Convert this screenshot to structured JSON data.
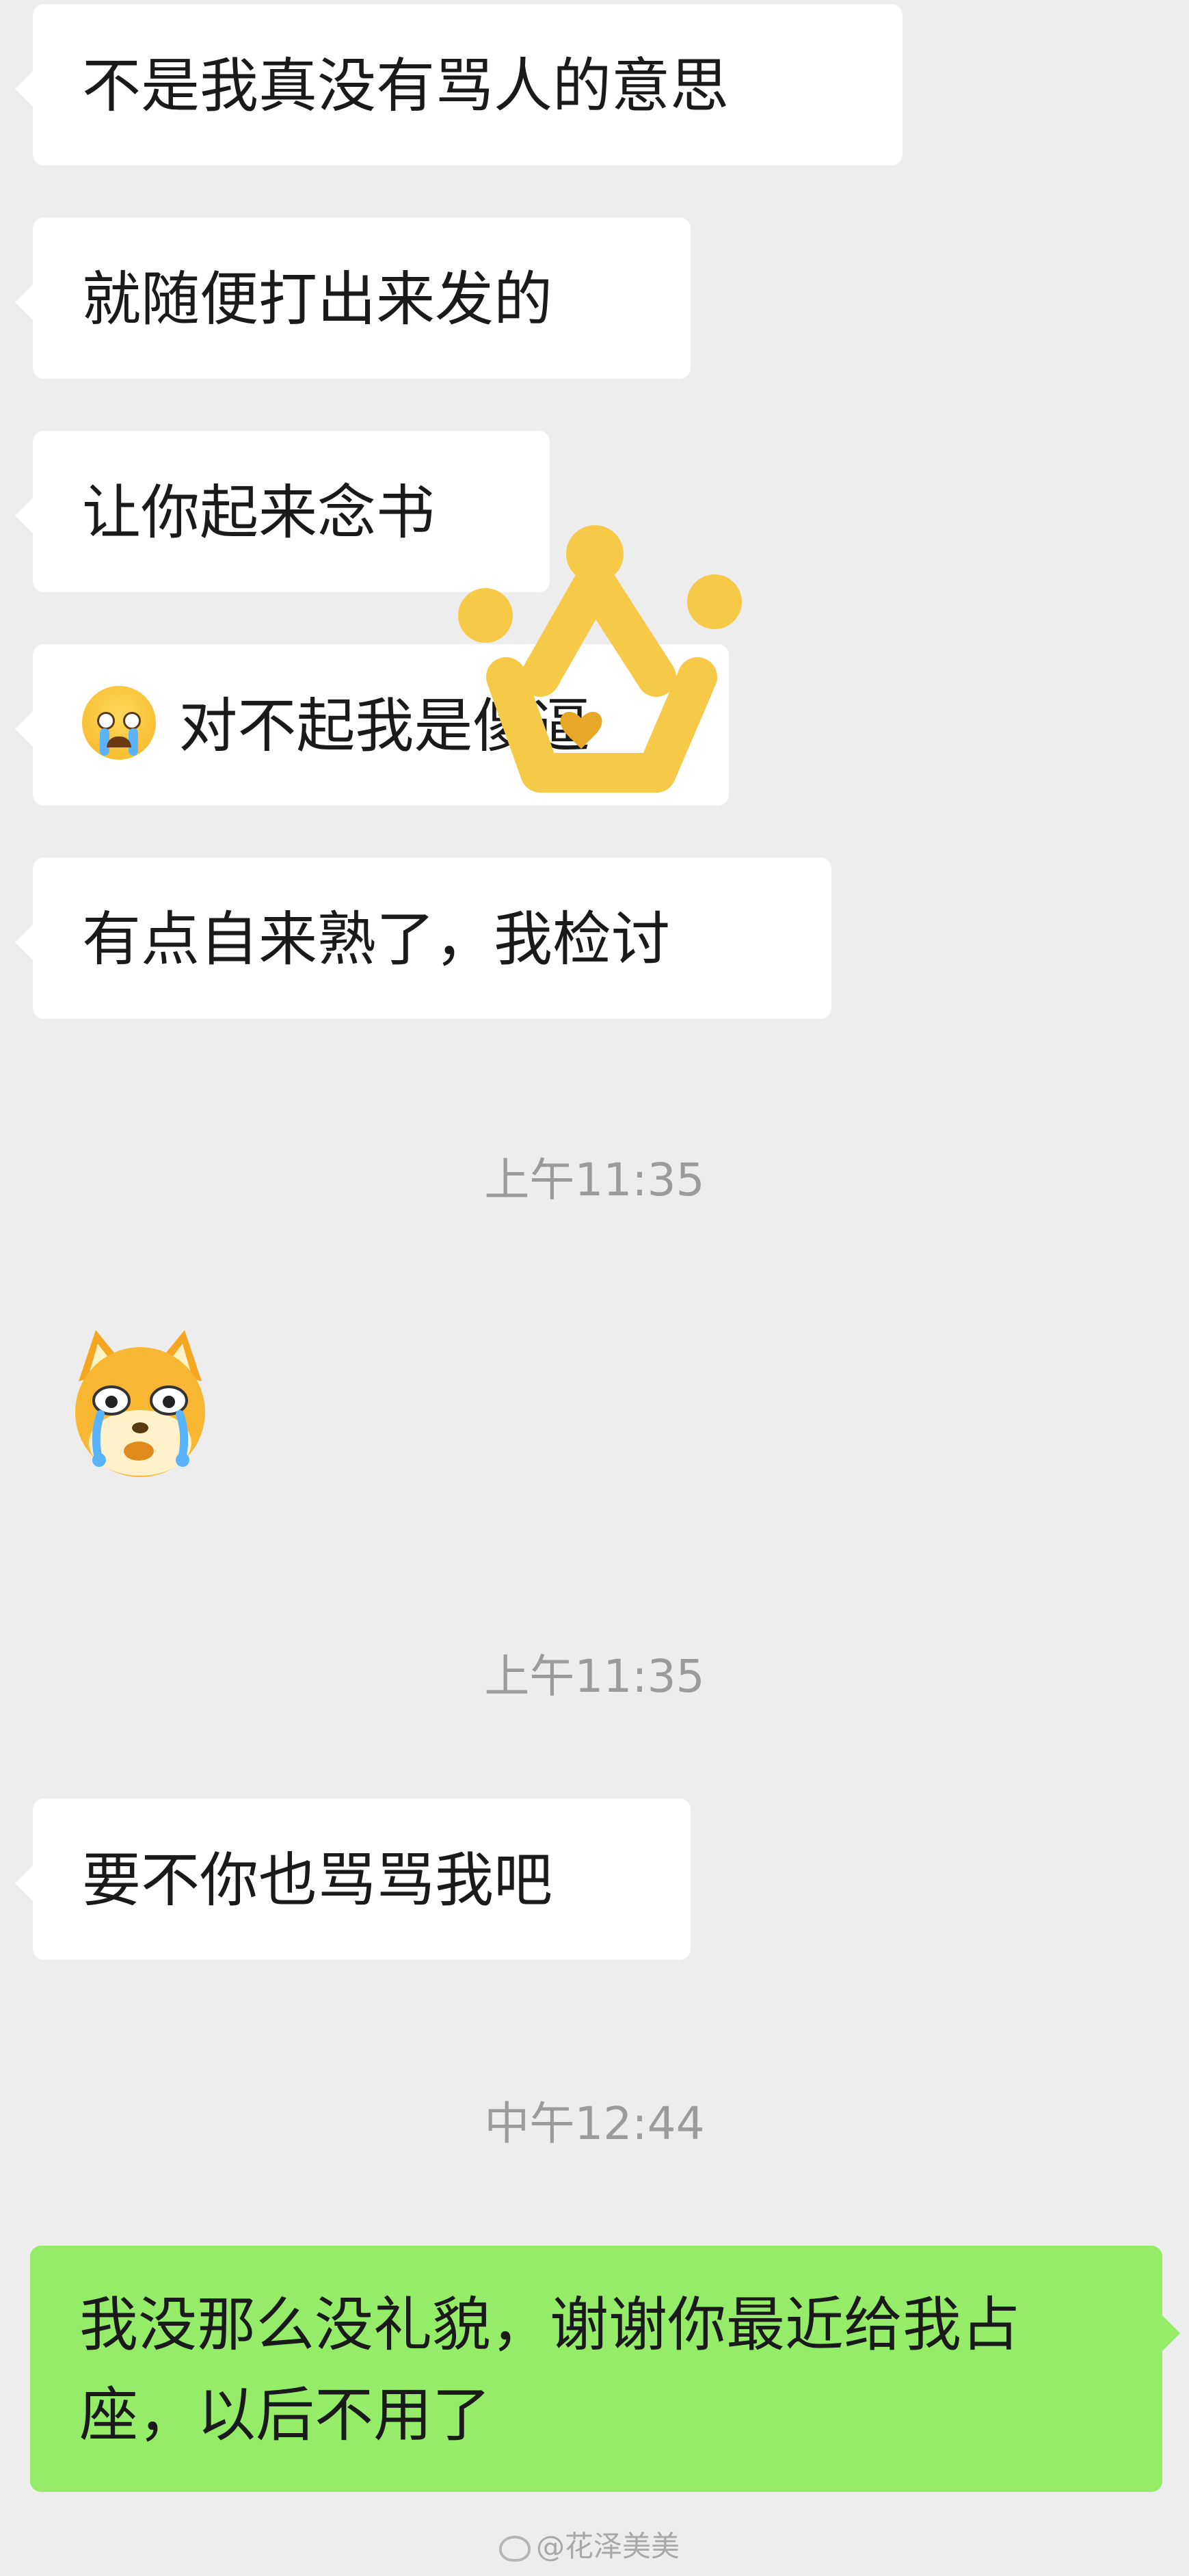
{
  "messages": [
    {
      "text": "不是我真没有骂人的意思"
    },
    {
      "text": "就随便打出来发的"
    },
    {
      "text": "让你起来念书"
    },
    {
      "text": "对不起我是傻逼",
      "emoji": "crying-face-emoji"
    },
    {
      "text": "有点自来熟了，我检讨"
    },
    {
      "text": "要不你也骂骂我吧"
    },
    {
      "text": "我没那么没礼貌，谢谢你最近给我占座，以后不用了"
    }
  ],
  "timestamps": [
    "上午11:35",
    "上午11:35",
    "中午12:44"
  ],
  "sticker": {
    "icon": "crying-shiba-dog-sticker"
  },
  "overlay": {
    "icon": "crown-sticker",
    "color": "#f7c948"
  },
  "watermark": {
    "text": "@花泽美美"
  },
  "colors": {
    "background": "#ededed",
    "incoming_bubble": "#ffffff",
    "outgoing_bubble": "#95ec69",
    "timestamp": "#9b9b9b"
  }
}
